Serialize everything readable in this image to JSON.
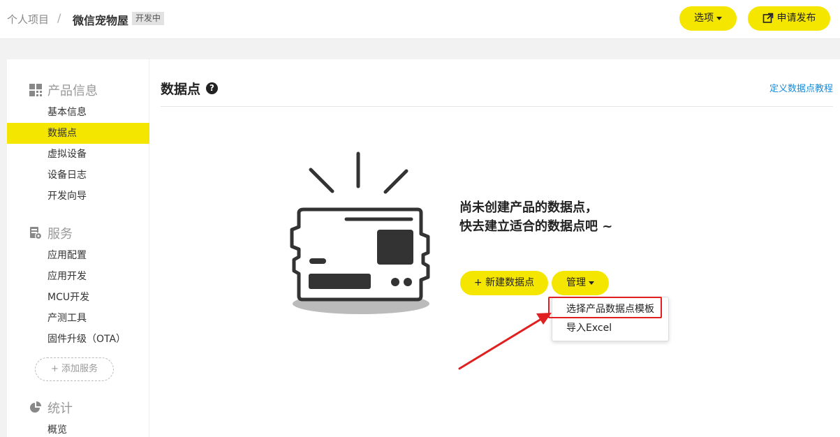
{
  "breadcrumb": {
    "root": "个人项目",
    "separator": "/",
    "project": "微信宠物屋",
    "status_badge": "开发中"
  },
  "header": {
    "options_label": "选项",
    "publish_label": "申请发布"
  },
  "sidebar": {
    "sections": [
      {
        "title": "产品信息",
        "icon": "grid-icon",
        "items": [
          "基本信息",
          "数据点",
          "虚拟设备",
          "设备日志",
          "开发向导"
        ]
      },
      {
        "title": "服务",
        "icon": "service-icon",
        "items": [
          "应用配置",
          "应用开发",
          "MCU开发",
          "产测工具",
          "固件升级（OTA）"
        ]
      },
      {
        "title": "统计",
        "icon": "pie-chart-icon",
        "items": [
          "概览"
        ]
      }
    ],
    "active_item": "数据点",
    "add_service_label": "+ 添加服务"
  },
  "main": {
    "title": "数据点",
    "tutorial_link": "定义数据点教程",
    "empty_line1": "尚未创建产品的数据点，",
    "empty_line2": "快去建立适合的数据点吧 ~",
    "new_button": "+ 新建数据点",
    "manage_button": "管理",
    "manage_menu": [
      "选择产品数据点模板",
      "导入Excel"
    ]
  },
  "colors": {
    "accent": "#f5e600",
    "link": "#1a8cd8",
    "highlight": "#e02020"
  }
}
